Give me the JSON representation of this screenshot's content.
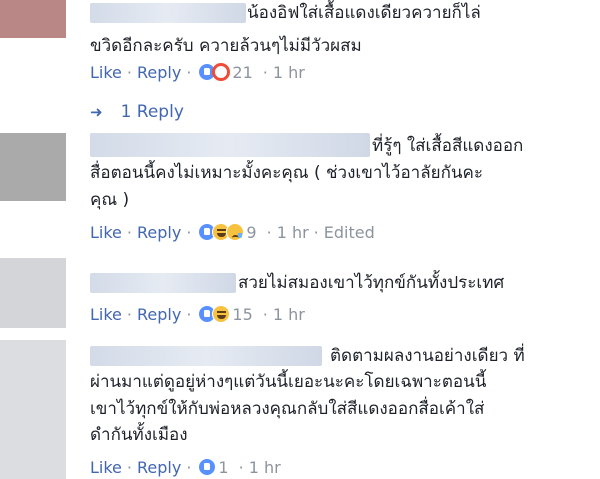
{
  "comments": [
    {
      "lines": [
        "น้องอิฟใส่เสื้อแดงเดียวควายก็ไล่",
        "ขวิดอีกละครับ ควายล้วนๆไม่มีวัวผสม"
      ],
      "like_label": "Like",
      "reply_label": "Reply",
      "reactions": [
        "like",
        "angry"
      ],
      "count": "21",
      "time": "1 hr",
      "avatar_color": "#b98886"
    },
    {
      "lines": [
        "ที่รู้ๆ ใส่เสื้อสีแดงออก",
        "สื่อตอนนี้คงไม่เหมาะมั้งคะคุณ ( ช่วงเขาไว้อาลัยกันคะ",
        "คุณ )"
      ],
      "like_label": "Like",
      "reply_label": "Reply",
      "reactions": [
        "like",
        "haha",
        "sad"
      ],
      "count": "9",
      "time": "1 hr",
      "edited": "Edited",
      "avatar_color": "#aaaaaa"
    },
    {
      "lines": [
        "สวยไม่สมองเขาไว้ทุกข์กันทั้งประเทศ"
      ],
      "like_label": "Like",
      "reply_label": "Reply",
      "reactions": [
        "like",
        "haha"
      ],
      "count": "15",
      "time": "1 hr",
      "avatar_color": "#d4d5d9"
    },
    {
      "lines": [
        "ติดตามผลงานอย่างเดียว ที่",
        "ผ่านมาแต่ดูอยู่ห่างๆแต่วันนี้เยอะนะคะโดยเฉพาะตอนนี้",
        "เขาไว้ทุกข์ให้กับพ่อหลวงคุณกลับใส่สีแดงออกสื่อเค้าใส่",
        "ดำกันทั้งเมือง"
      ],
      "like_label": "Like",
      "reply_label": "Reply",
      "reactions": [
        "like"
      ],
      "count": "1",
      "time": "1 hr",
      "avatar_color": "#dcdde1"
    }
  ],
  "replies_link": {
    "label": "1 Reply"
  },
  "separator": "·",
  "colors": {
    "link": "#4267b2",
    "meta": "#8d949e",
    "text": "#1d2129"
  }
}
